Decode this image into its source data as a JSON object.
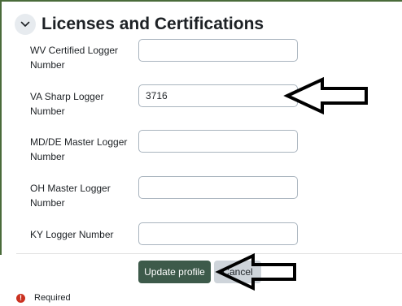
{
  "section": {
    "title": "Licenses and Certifications",
    "toggle_icon": "chevron-down-icon"
  },
  "fields": [
    {
      "label": "WV Certified Logger Number",
      "value": ""
    },
    {
      "label": "VA Sharp Logger Number",
      "value": "3716"
    },
    {
      "label": "MD/DE Master Logger Number",
      "value": ""
    },
    {
      "label": "OH Master Logger Number",
      "value": ""
    },
    {
      "label": "KY Logger Number",
      "value": ""
    }
  ],
  "actions": {
    "update_label": "Update profile",
    "cancel_label": "Cancel"
  },
  "required": {
    "icon": "exclamation-circle-icon",
    "text": "Required"
  },
  "colors": {
    "frame_border": "#4a6b3a",
    "primary_button": "#3d5a4a",
    "required_icon": "#ca3120",
    "annotation_arrow": "#000000"
  }
}
